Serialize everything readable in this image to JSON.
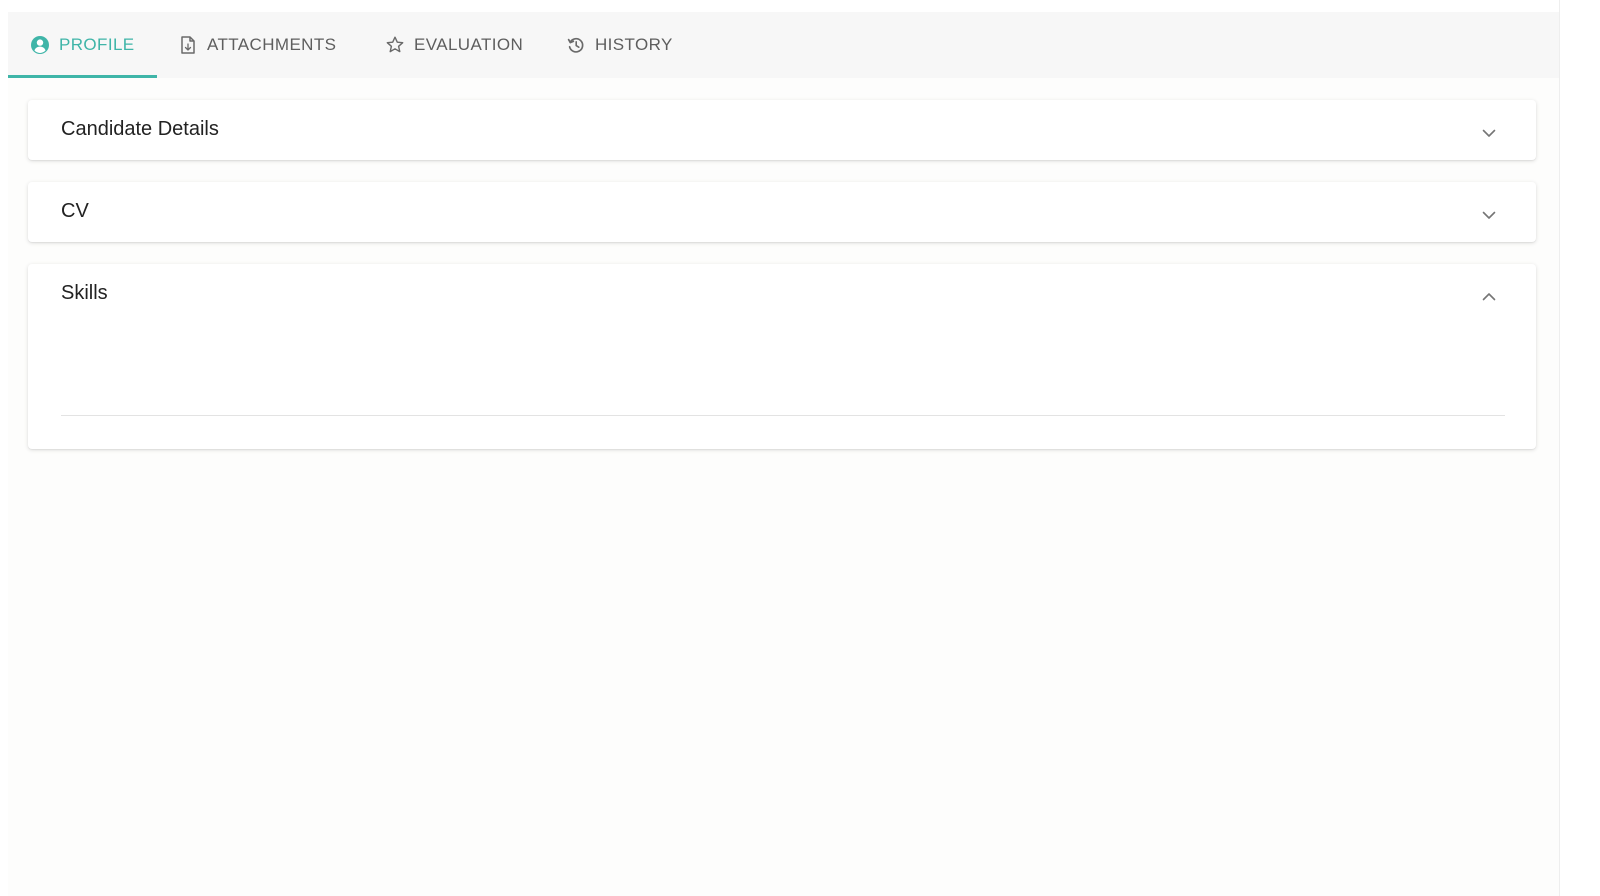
{
  "tabs": [
    {
      "label": "PROFILE",
      "icon": "account-circle-icon",
      "active": true
    },
    {
      "label": "ATTACHMENTS",
      "icon": "document-icon",
      "active": false
    },
    {
      "label": "EVALUATION",
      "icon": "star-icon",
      "active": false
    },
    {
      "label": "HISTORY",
      "icon": "history-icon",
      "active": false
    }
  ],
  "panels": [
    {
      "title": "Candidate Details",
      "expanded": false
    },
    {
      "title": "CV",
      "expanded": false
    },
    {
      "title": "Skills",
      "expanded": true
    }
  ],
  "colors": {
    "accent": "#3fb5a8",
    "tab_inactive": "#5e5e5e",
    "tabbar_bg": "#f7f7f7"
  }
}
